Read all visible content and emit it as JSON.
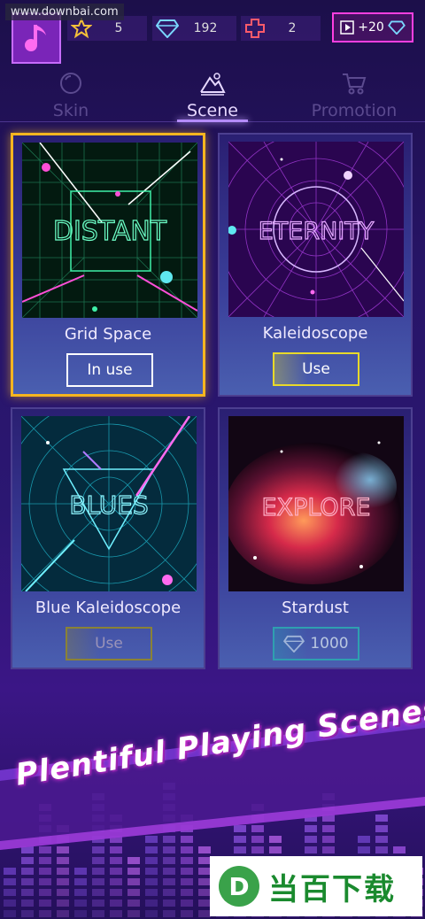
{
  "watermark": "www.downbai.com",
  "header": {
    "stars": "5",
    "gems": "192",
    "plus_count": "2",
    "video_reward": "+20"
  },
  "tabs": [
    {
      "label": "Skin",
      "icon": "ball-icon"
    },
    {
      "label": "Scene",
      "icon": "mountain-icon",
      "active": true
    },
    {
      "label": "Promotion",
      "icon": "cart-icon"
    }
  ],
  "scenes": [
    {
      "title": "Grid Space",
      "thumb_text": "DISTANT",
      "button": "In use",
      "state": "in-use"
    },
    {
      "title": "Kaleidoscope",
      "thumb_text": "ETERNITY",
      "button": "Use",
      "state": "owned"
    },
    {
      "title": "Blue Kaleidoscope",
      "thumb_text": "BLUES",
      "button": "Use",
      "state": "owned-dim"
    },
    {
      "title": "Stardust",
      "thumb_text": "EXPLORE",
      "button": "1000",
      "state": "locked",
      "price_icon": "diamond-icon"
    }
  ],
  "banner": {
    "text": "Plentiful Playing Scenes"
  },
  "logo": {
    "badge": "D",
    "text": "当百下载"
  },
  "colors": {
    "selected_border": "#f5b520",
    "use_border": "#e8d92a",
    "price_border": "#2f9fb0",
    "accent_pink": "#ff3fe0"
  }
}
